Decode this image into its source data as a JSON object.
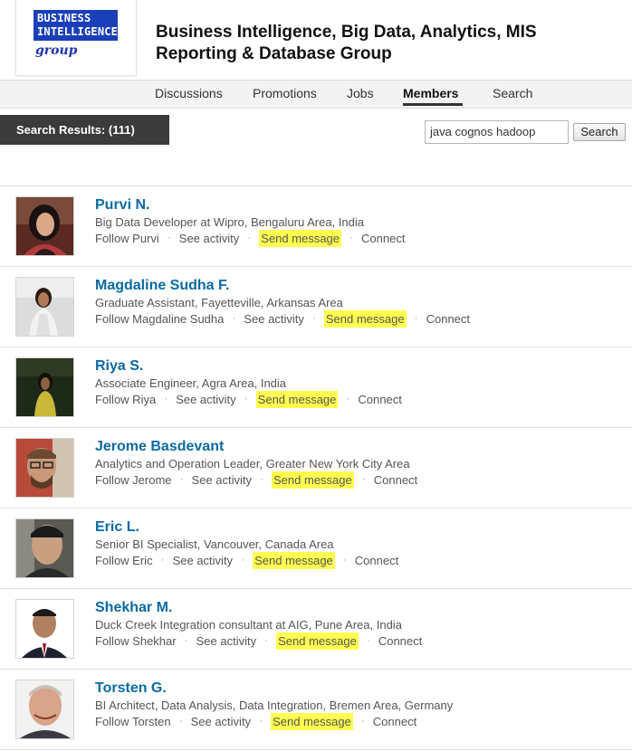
{
  "group": {
    "logo_line1": "BUSINESS",
    "logo_line2": "INTELLIGENCE",
    "logo_line3": "group",
    "title_line1": "Business Intelligence, Big Data, Analytics, MIS",
    "title_line2": "Reporting & Database Group"
  },
  "nav": {
    "items": [
      {
        "label": "Discussions"
      },
      {
        "label": "Promotions"
      },
      {
        "label": "Jobs"
      },
      {
        "label": "Members",
        "active": true
      },
      {
        "label": "Search"
      }
    ]
  },
  "search": {
    "results_label": "Search Results: (111)",
    "query": "java cognos hadoop",
    "button_label": "Search"
  },
  "actions": {
    "see_activity": "See activity",
    "send_message": "Send message",
    "connect": "Connect",
    "separator": "·"
  },
  "members": [
    {
      "name": "Purvi N.",
      "headline": "Big Data Developer at Wipro, Bengaluru Area, India",
      "follow": "Follow Purvi"
    },
    {
      "name": "Magdaline Sudha F.",
      "headline": "Graduate Assistant, Fayetteville, Arkansas Area",
      "follow": "Follow Magdaline Sudha"
    },
    {
      "name": "Riya S.",
      "headline": "Associate Engineer, Agra Area, India",
      "follow": "Follow Riya"
    },
    {
      "name": "Jerome Basdevant",
      "headline": "Analytics and Operation Leader, Greater New York City Area",
      "follow": "Follow Jerome"
    },
    {
      "name": "Eric L.",
      "headline": "Senior BI Specialist, Vancouver, Canada Area",
      "follow": "Follow Eric"
    },
    {
      "name": "Shekhar M.",
      "headline": "Duck Creek Integration consultant at AIG, Pune Area, India",
      "follow": "Follow Shekhar"
    },
    {
      "name": "Torsten G.",
      "headline": "BI Architect, Data Analysis, Data Integration, Bremen Area, Germany",
      "follow": "Follow Torsten"
    }
  ],
  "colors": {
    "link": "#0a6aa1",
    "highlight": "#ffff50",
    "results_bar": "#3b3b3b",
    "logo_blue": "#1b3fb8"
  }
}
